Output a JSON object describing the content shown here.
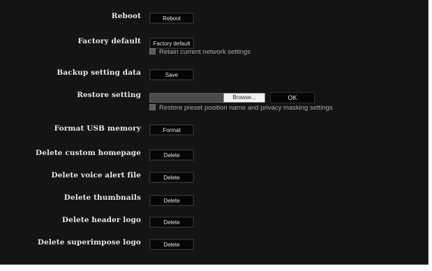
{
  "rows": {
    "reboot": {
      "label": "Reboot",
      "button": "Reboot"
    },
    "factory_default": {
      "label": "Factory default",
      "button": "Factory default",
      "checkbox_label": "Retain current network settings",
      "checkbox_checked": false
    },
    "backup": {
      "label": "Backup setting data",
      "button": "Save"
    },
    "restore": {
      "label": "Restore setting",
      "file_value": "",
      "browse_button": "Browse...",
      "ok_button": "OK",
      "checkbox_label": "Restore preset position name and privacy masking settings",
      "checkbox_checked": false
    },
    "format_usb": {
      "label": "Format USB memory",
      "button": "Format"
    },
    "delete_homepage": {
      "label": "Delete custom homepage",
      "button": "Delete"
    },
    "delete_voice": {
      "label": "Delete voice alert file",
      "button": "Delete"
    },
    "delete_thumbnails": {
      "label": "Delete thumbnails",
      "button": "Delete"
    },
    "delete_header_logo": {
      "label": "Delete header logo",
      "button": "Delete"
    },
    "delete_superimpose": {
      "label": "Delete superimpose logo",
      "button": "Delete"
    }
  },
  "colors": {
    "panel_background": "#141414",
    "button_background": "#050505",
    "label_text": "#e6e6e6",
    "checkbox_text": "#a9a9a9"
  }
}
